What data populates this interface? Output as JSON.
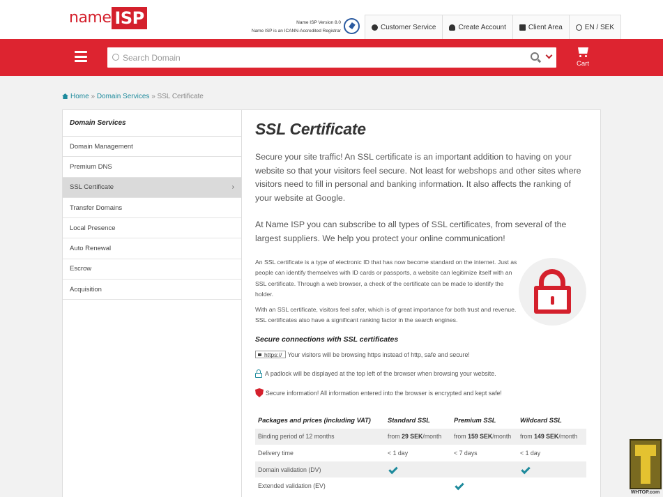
{
  "header": {
    "logo_name": "name",
    "logo_isp": "ISP",
    "version_line1": "Name ISP Version 8.0",
    "version_line2": "Name ISP is an ICANN-Accredited Registrar",
    "nav": [
      {
        "label": "Customer Service",
        "icon": "chat-icon"
      },
      {
        "label": "Create Account",
        "icon": "user-icon"
      },
      {
        "label": "Client Area",
        "icon": "briefcase-icon"
      },
      {
        "label": "EN / SEK",
        "icon": "globe-icon"
      }
    ]
  },
  "search": {
    "placeholder": "Search Domain",
    "value": ""
  },
  "cart": {
    "label": "Cart"
  },
  "breadcrumb": {
    "home": "Home",
    "sep1": "»",
    "section": "Domain Services",
    "sep2": "»",
    "current": "SSL Certificate"
  },
  "sidebar": {
    "title": "Domain Services",
    "items": [
      {
        "label": "Domain Management"
      },
      {
        "label": "Premium DNS"
      },
      {
        "label": "SSL Certificate",
        "arrow": "›"
      },
      {
        "label": "Transfer Domains"
      },
      {
        "label": "Local Presence"
      },
      {
        "label": "Auto Renewal"
      },
      {
        "label": "Escrow"
      },
      {
        "label": "Acquisition"
      }
    ]
  },
  "main": {
    "title": "SSL Certificate",
    "lead1": "Secure your site traffic! An SSL certificate is an important addition to having on your website so that your visitors feel secure. Not least for webshops and other sites where visitors need to fill in personal and banking information. It also affects the ranking of your website at Google.",
    "lead2": "At Name ISP you can subscribe to all types of SSL certificates, from several of the largest suppliers. We help you protect your online communication!",
    "para1": "An SSL certificate is a type of electronic ID that has now become standard on the internet. Just as people can identify themselves with ID cards or passports, a website can legitimize itself with an SSL certificate. Through a web browser, a check of the certificate can be made to identify the holder.",
    "para2": "With an SSL certificate, visitors feel safer, which is of great importance for both trust and revenue. SSL certificates also have a significant ranking factor in the search engines.",
    "features_title": "Secure connections with SSL certificates",
    "https_label": "https://",
    "feature1": "Your visitors will be browsing https instead of http, safe and secure!",
    "feature2": "A padlock will be displayed at the top left of the browser when browsing your website.",
    "feature3": "Secure information! All information entered into the browser is encrypted and kept safe!"
  },
  "pricing": {
    "headers": [
      "Packages and prices (including VAT)",
      "Standard SSL",
      "Premium SSL",
      "Wildcard SSL"
    ],
    "binding_label": "Binding period of 12 months",
    "from": "from",
    "per_month": "/month",
    "prices": [
      "29 SEK",
      "159 SEK",
      "149 SEK"
    ],
    "delivery_label": "Delivery time",
    "delivery": [
      "< 1 day",
      "< 7 days",
      "< 1 day"
    ],
    "dv_label": "Domain validation (DV)",
    "ev_label": "Extended validation (EV)"
  },
  "watermark": {
    "text": "WHTOP.com"
  },
  "colors": {
    "brand_red": "#dd2430",
    "accent_teal": "#1d8a9c"
  }
}
